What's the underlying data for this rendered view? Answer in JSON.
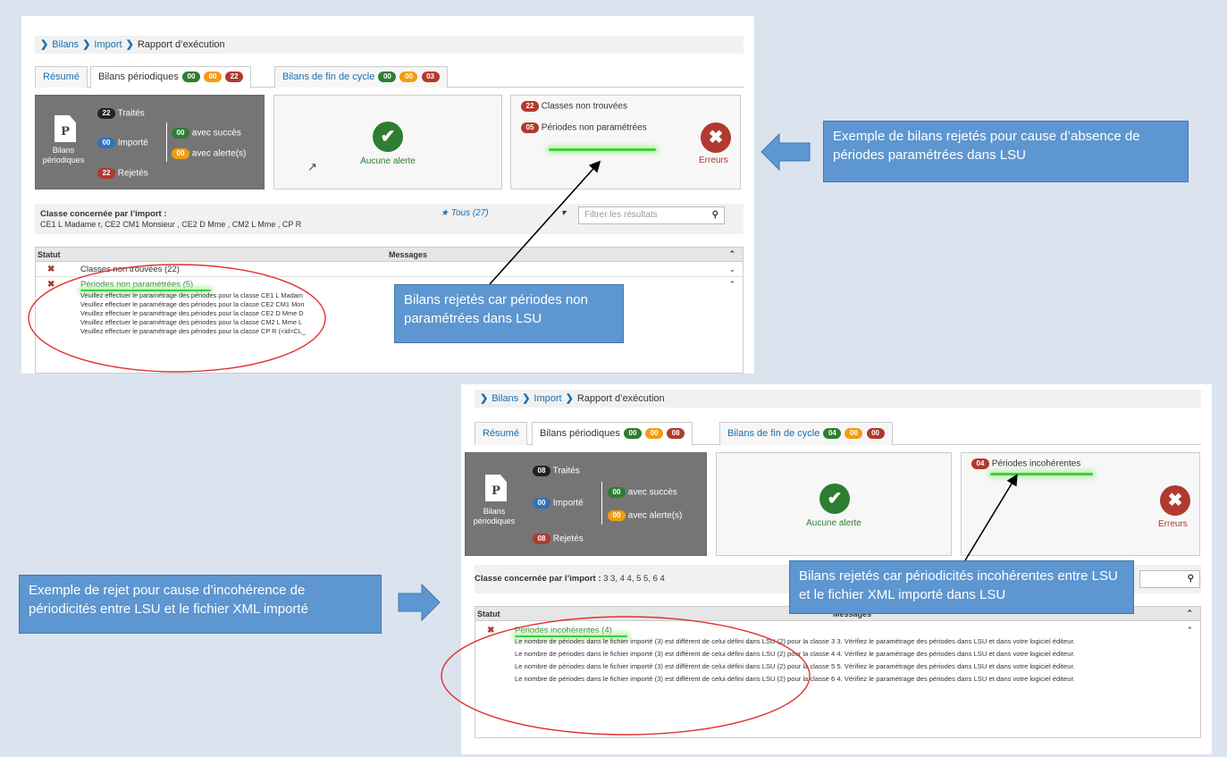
{
  "shot1": {
    "breadcrumb": {
      "item1": "Bilans",
      "item2": "Import",
      "item3": "Rapport d’exécution"
    },
    "tabs": {
      "resume": "Résumé",
      "periodiques": "Bilans périodiques",
      "periodiques_badges": [
        "00",
        "00",
        "22"
      ],
      "fin_cycle": "Bilans de fin de cycle",
      "fin_cycle_badges": [
        "00",
        "00",
        "03"
      ]
    },
    "summary": {
      "icon_label": "Bilans périodiques",
      "traites_count": "22",
      "traites_label": "Traités",
      "importe_count": "00",
      "importe_label": "Importé",
      "rejetes_count": "22",
      "rejetes_label": "Rejetés",
      "succes_count": "00",
      "succes_label": "avec succès",
      "alerte_count": "00",
      "alerte_label": "avec alerte(s)"
    },
    "alerts": {
      "label": "Aucune alerte"
    },
    "errors": {
      "items": [
        {
          "count": "22",
          "label": "Classes non trouvées"
        },
        {
          "count": "05",
          "label": "Périodes non paramétrées"
        }
      ],
      "label": "Erreurs"
    },
    "filter": {
      "title": "Classe concernée par l’import :",
      "classes": "CE1 L Madame          r, CE2 CM1 Monsieur          , CE2 D Mme          , CM2 L Mme          , CP R",
      "dropdown": "Tous (27)",
      "search_placeholder": "Filtrer les résultats"
    },
    "table": {
      "col_statut": "Statut",
      "col_messages": "Messages",
      "row1": "Classes non trouvées (22)",
      "row2_title": "Périodes non paramétrées (5)",
      "row2_lines": [
        "Veuillez effectuer le paramétrage des périodes pour la classe CE1 L Madam",
        "Veuillez effectuer le paramétrage des périodes pour la classe CE2 CM1 Mon",
        "Veuillez effectuer le paramétrage des périodes pour la classe CE2 D Mme D",
        "Veuillez effectuer le paramétrage des périodes pour la classe CM2 L Mme L",
        "Veuillez effectuer le paramétrage des périodes pour la classe CP R (<id=CL_"
      ]
    }
  },
  "shot2": {
    "breadcrumb": {
      "item1": "Bilans",
      "item2": "Import",
      "item3": "Rapport d’exécution"
    },
    "tabs": {
      "resume": "Résumé",
      "periodiques": "Bilans périodiques",
      "periodiques_badges": [
        "00",
        "00",
        "08"
      ],
      "fin_cycle": "Bilans de fin de cycle",
      "fin_cycle_badges": [
        "04",
        "00",
        "00"
      ]
    },
    "summary": {
      "icon_label": "Bilans périodiques",
      "traites_count": "08",
      "traites_label": "Traités",
      "importe_count": "00",
      "importe_label": "Importé",
      "rejetes_count": "08",
      "rejetes_label": "Rejetés",
      "succes_count": "00",
      "succes_label": "avec succès",
      "alerte_count": "00",
      "alerte_label": "avec alerte(s)"
    },
    "alerts": {
      "label": "Aucune alerte"
    },
    "errors": {
      "items": [
        {
          "count": "04",
          "label": "Périodes incohérentes"
        }
      ],
      "label": "Erreurs"
    },
    "filter": {
      "title": "Classe concernée par l’import :",
      "classes": " 3 3, 4 4, 5 5, 6 4"
    },
    "table": {
      "col_statut": "Statut",
      "col_messages": "Messages",
      "row_title": "Périodes incohérentes (4)",
      "lines": [
        "Le nombre de périodes dans le fichier importé (3) est différent de celui défini dans LSU (2) pour la classe 3 3. Vérifiez le paramétrage des périodes dans LSU et dans votre logiciel éditeur.",
        "Le nombre de périodes dans le fichier importé (3) est différent de celui défini dans LSU (2) pour la classe 4 4. Vérifiez le paramétrage des périodes dans LSU et dans votre logiciel éditeur.",
        "Le nombre de périodes dans le fichier importé (3) est différent de celui défini dans LSU (2) pour la classe 5 5. Vérifiez le paramétrage des périodes dans LSU et dans votre logiciel éditeur.",
        "Le nombre de périodes dans le fichier importé (3) est différent de celui défini dans LSU (2) pour la classe 6 4. Vérifiez le paramétrage des périodes dans LSU et dans votre logiciel éditeur."
      ]
    }
  },
  "callouts": {
    "top_right": "Exemple de bilans rejetés pour cause d’absence de périodes paramétrées dans LSU",
    "mid": "Bilans rejetés car périodes non paramétrées dans LSU",
    "bottom_left": "Exemple de rejet pour cause d’incohérence de périodicités entre LSU et le fichier XML importé",
    "bottom_right": "Bilans rejetés car périodicités incohérentes entre LSU et le fichier XML importé dans LSU"
  },
  "colors": {
    "green": "#2e7d32",
    "orange": "#f39c12",
    "red": "#b03a2e",
    "link": "#1a6fb0",
    "callout": "#5d96d0"
  }
}
